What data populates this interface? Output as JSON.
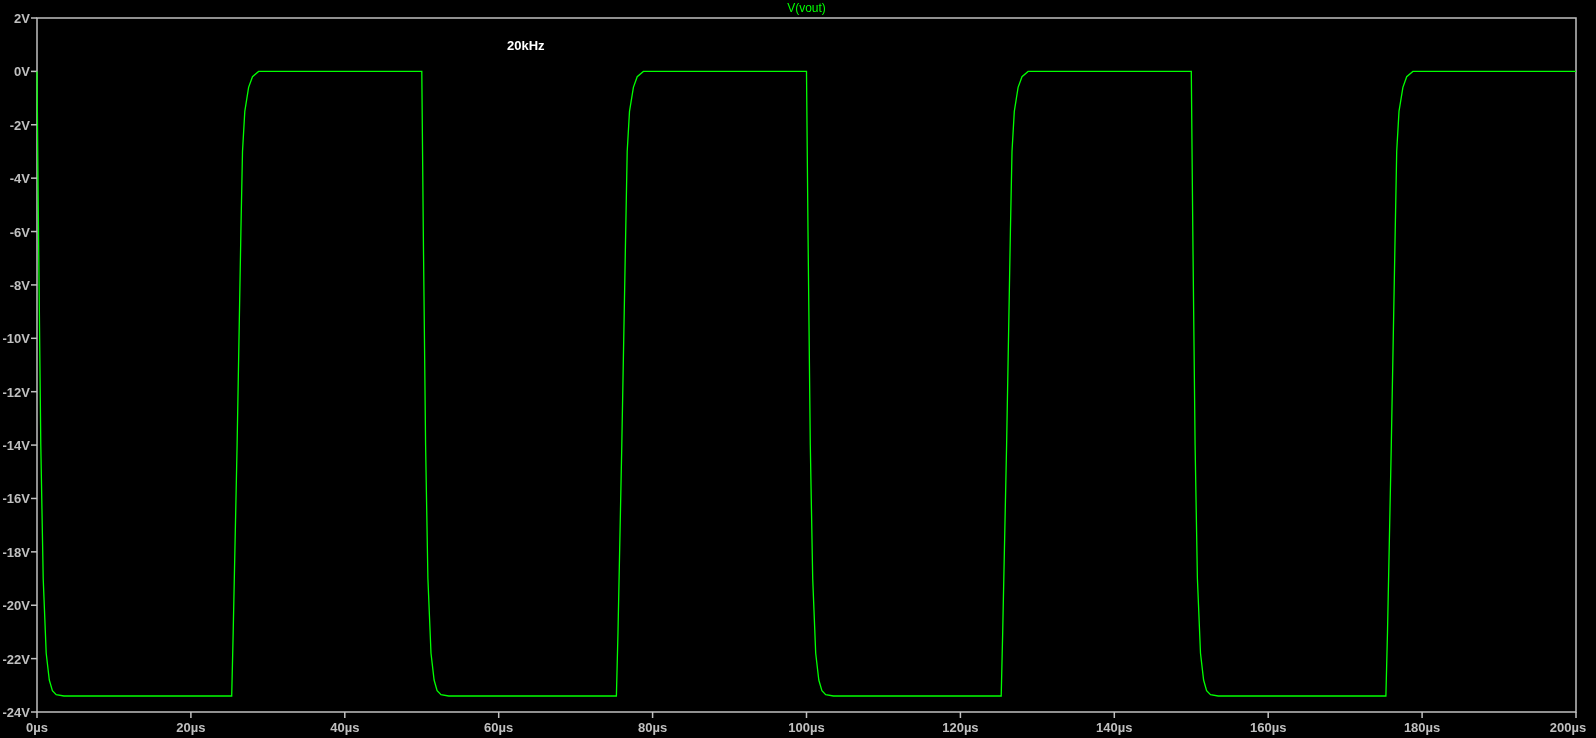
{
  "plot": {
    "chart_data": {
      "type": "line",
      "x": [
        0,
        0.2,
        0.5,
        0.8,
        1.2,
        1.6,
        2,
        2.5,
        3.5,
        25.3,
        25.5,
        26,
        26.5,
        26.7,
        27,
        27.5,
        28,
        28.8,
        50,
        50.2,
        50.5,
        50.8,
        51.2,
        51.6,
        52,
        52.5,
        53.5,
        75.3,
        75.5,
        76,
        76.5,
        76.7,
        77,
        77.5,
        78,
        78.8,
        100,
        100.2,
        100.5,
        100.8,
        101.2,
        101.6,
        102,
        102.5,
        103.5,
        125.3,
        125.5,
        126,
        126.5,
        126.7,
        127,
        127.5,
        128,
        128.8,
        150,
        150.2,
        150.5,
        150.8,
        151.2,
        151.6,
        152,
        152.5,
        153.5,
        175.3,
        175.5,
        176,
        176.5,
        176.7,
        177,
        177.5,
        178,
        178.8,
        200
      ],
      "series": [
        {
          "name": "V(vout)",
          "color": "#00ff00",
          "values": [
            0,
            -6,
            -14,
            -19,
            -21.8,
            -22.8,
            -23.2,
            -23.35,
            -23.4,
            -23.4,
            -21,
            -14,
            -6,
            -3,
            -1.5,
            -0.6,
            -0.2,
            0,
            0,
            -6,
            -14,
            -19,
            -21.8,
            -22.8,
            -23.2,
            -23.35,
            -23.4,
            -23.4,
            -21,
            -14,
            -6,
            -3,
            -1.5,
            -0.6,
            -0.2,
            0,
            0,
            -6,
            -14,
            -19,
            -21.8,
            -22.8,
            -23.2,
            -23.35,
            -23.4,
            -23.4,
            -21,
            -14,
            -6,
            -3,
            -1.5,
            -0.6,
            -0.2,
            0,
            0,
            -6,
            -14,
            -19,
            -21.8,
            -22.8,
            -23.2,
            -23.35,
            -23.4,
            -23.4,
            -21,
            -14,
            -6,
            -3,
            -1.5,
            -0.6,
            -0.2,
            0,
            0
          ]
        }
      ],
      "xlim": [
        0,
        200
      ],
      "ylim": [
        -24,
        2
      ],
      "xticks": [
        {
          "value": 0,
          "label": "0µs"
        },
        {
          "value": 20,
          "label": "20µs"
        },
        {
          "value": 40,
          "label": "40µs"
        },
        {
          "value": 60,
          "label": "60µs"
        },
        {
          "value": 80,
          "label": "80µs"
        },
        {
          "value": 100,
          "label": "100µs"
        },
        {
          "value": 120,
          "label": "120µs"
        },
        {
          "value": 140,
          "label": "140µs"
        },
        {
          "value": 160,
          "label": "160µs"
        },
        {
          "value": 180,
          "label": "180µs"
        },
        {
          "value": 200,
          "label": "200µs"
        }
      ],
      "yticks": [
        {
          "value": 2,
          "label": "2V"
        },
        {
          "value": 0,
          "label": "0V"
        },
        {
          "value": -2,
          "label": "-2V"
        },
        {
          "value": -4,
          "label": "-4V"
        },
        {
          "value": -6,
          "label": "-6V"
        },
        {
          "value": -8,
          "label": "-8V"
        },
        {
          "value": -10,
          "label": "-10V"
        },
        {
          "value": -12,
          "label": "-12V"
        },
        {
          "value": -14,
          "label": "-14V"
        },
        {
          "value": -16,
          "label": "-16V"
        },
        {
          "value": -18,
          "label": "-18V"
        },
        {
          "value": -20,
          "label": "-20V"
        },
        {
          "value": -22,
          "label": "-22V"
        },
        {
          "value": -24,
          "label": "-24V"
        }
      ],
      "annotations": [
        "20kHz"
      ]
    }
  }
}
